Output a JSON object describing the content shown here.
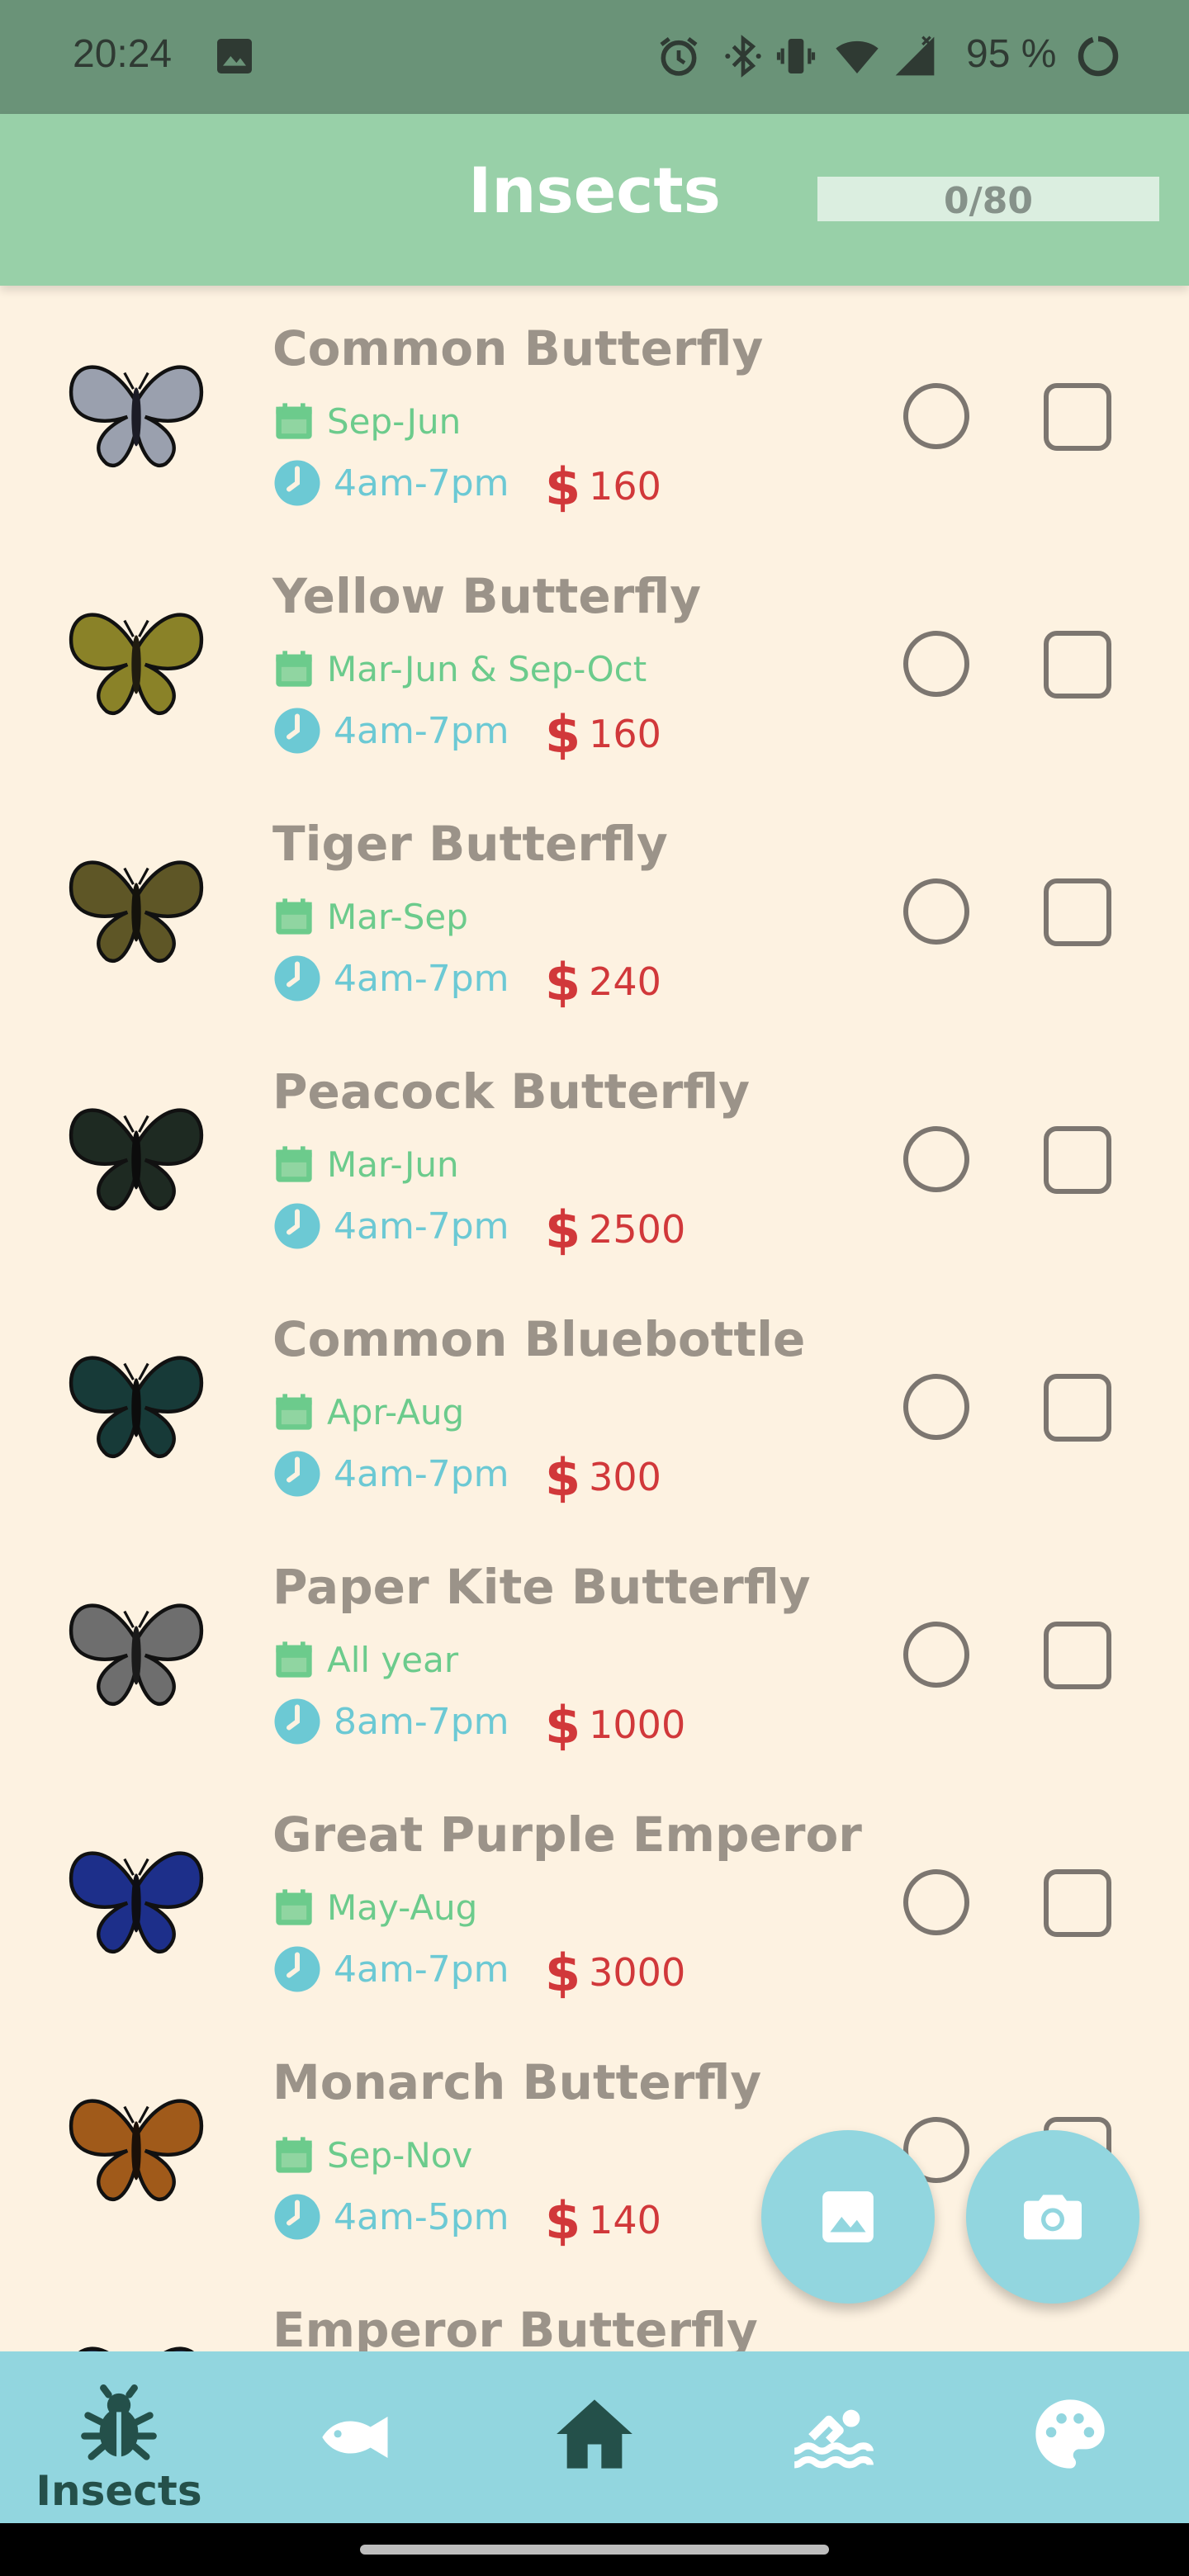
{
  "status_bar": {
    "time": "20:24",
    "battery": "95 %",
    "icons": [
      "image-icon",
      "alarm-icon",
      "bluetooth-icon",
      "vibrate-icon",
      "wifi-icon",
      "cell-signal-icon",
      "battery-icon"
    ]
  },
  "header": {
    "title": "Insects",
    "progress_text": "0/80",
    "progress_fraction": 0
  },
  "colors": {
    "header_bg": "#98d0a8",
    "list_bg": "#fdf2e1",
    "month_green": "#6ccb8c",
    "time_cyan": "#6cc9d4",
    "price_red": "#d1383a",
    "nav_bg": "#92d6df"
  },
  "insects": [
    {
      "name": "Common Butterfly",
      "months": "Sep-Jun",
      "hours": "4am-7pm",
      "price": "160",
      "wing": "#9aa0ae",
      "body": "#1c1c26"
    },
    {
      "name": "Yellow Butterfly",
      "months": "Mar-Jun & Sep-Oct",
      "hours": "4am-7pm",
      "price": "160",
      "wing": "#8a8228",
      "body": "#201c10"
    },
    {
      "name": "Tiger Butterfly",
      "months": "Mar-Sep",
      "hours": "4am-7pm",
      "price": "240",
      "wing": "#5e5626",
      "body": "#14120c"
    },
    {
      "name": "Peacock Butterfly",
      "months": "Mar-Jun",
      "hours": "4am-7pm",
      "price": "2500",
      "wing": "#1e2a22",
      "body": "#0c0c0c"
    },
    {
      "name": "Common Bluebottle",
      "months": "Apr-Aug",
      "hours": "4am-7pm",
      "price": "300",
      "wing": "#173a38",
      "body": "#0c0c0c"
    },
    {
      "name": "Paper Kite Butterfly",
      "months": "All year",
      "hours": "8am-7pm",
      "price": "1000",
      "wing": "#6e6e6e",
      "body": "#1a1a1a"
    },
    {
      "name": "Great Purple Emperor",
      "months": "May-Aug",
      "hours": "4am-7pm",
      "price": "3000",
      "wing": "#1d2f8a",
      "body": "#0e0e14"
    },
    {
      "name": "Monarch Butterfly",
      "months": "Sep-Nov",
      "hours": "4am-5pm",
      "price": "140",
      "wing": "#a05a1a",
      "body": "#1a1008"
    },
    {
      "name": "Emperor Butterfly",
      "months": "",
      "hours": "",
      "price": "",
      "wing": "#1a2a4a",
      "body": "#0c0c0c"
    }
  ],
  "fabs": [
    {
      "name": "gallery-button",
      "icon": "image-icon"
    },
    {
      "name": "camera-button",
      "icon": "camera-icon"
    }
  ],
  "bottom_nav": [
    {
      "id": "insects",
      "label": "Insects",
      "icon": "bug-icon",
      "active": true
    },
    {
      "id": "fish",
      "label": "",
      "icon": "fish-icon",
      "active": false
    },
    {
      "id": "home",
      "label": "",
      "icon": "home-icon",
      "active": false
    },
    {
      "id": "sea",
      "label": "",
      "icon": "swimmer-icon",
      "active": false
    },
    {
      "id": "art",
      "label": "",
      "icon": "palette-icon",
      "active": false
    }
  ]
}
